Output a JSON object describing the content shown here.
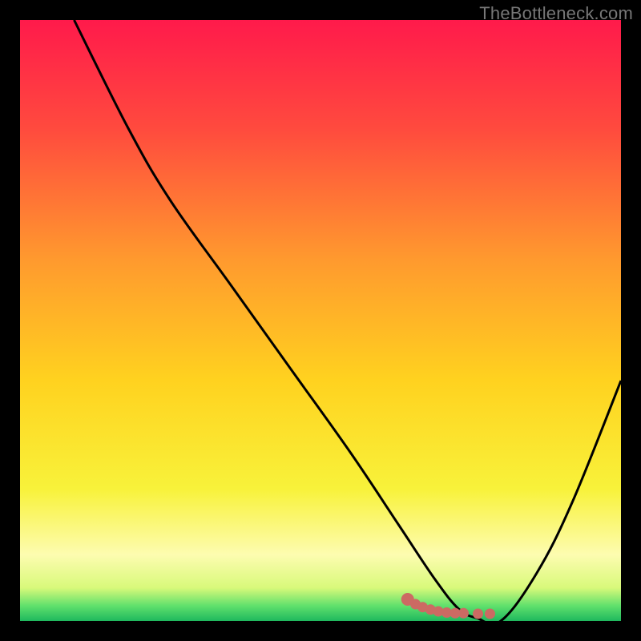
{
  "watermark": "TheBottleneck.com",
  "chart_data": {
    "type": "line",
    "title": "",
    "xlabel": "",
    "ylabel": "",
    "xlim": [
      0,
      100
    ],
    "ylim": [
      0,
      100
    ],
    "grid": false,
    "legend": false,
    "gradient_stops": [
      {
        "offset": 0,
        "color": "#ff1a4b"
      },
      {
        "offset": 0.18,
        "color": "#ff4a3e"
      },
      {
        "offset": 0.4,
        "color": "#ff9a2e"
      },
      {
        "offset": 0.6,
        "color": "#ffd21f"
      },
      {
        "offset": 0.78,
        "color": "#f8f23a"
      },
      {
        "offset": 0.89,
        "color": "#fdfcb0"
      },
      {
        "offset": 0.945,
        "color": "#d8f97a"
      },
      {
        "offset": 0.975,
        "color": "#5fe06c"
      },
      {
        "offset": 1.0,
        "color": "#1fb85e"
      }
    ],
    "series": [
      {
        "name": "bottleneck-curve",
        "color": "#000000",
        "x": [
          9,
          18,
          25,
          35,
          45,
          55,
          63,
          69,
          73,
          76,
          80,
          86,
          92,
          100
        ],
        "y": [
          100,
          82,
          70,
          56,
          42,
          28,
          16,
          7,
          2,
          0.5,
          0,
          8,
          20,
          40
        ]
      }
    ],
    "marker_trail": {
      "color": "#cc6a63",
      "points": [
        {
          "x": 64.5,
          "y": 3.6
        },
        {
          "x": 65.8,
          "y": 2.8
        },
        {
          "x": 67.0,
          "y": 2.3
        },
        {
          "x": 68.3,
          "y": 1.9
        },
        {
          "x": 69.6,
          "y": 1.6
        },
        {
          "x": 71.0,
          "y": 1.4
        },
        {
          "x": 72.4,
          "y": 1.3
        },
        {
          "x": 73.8,
          "y": 1.3
        },
        {
          "x": 76.2,
          "y": 1.2
        },
        {
          "x": 78.2,
          "y": 1.2
        }
      ]
    }
  }
}
